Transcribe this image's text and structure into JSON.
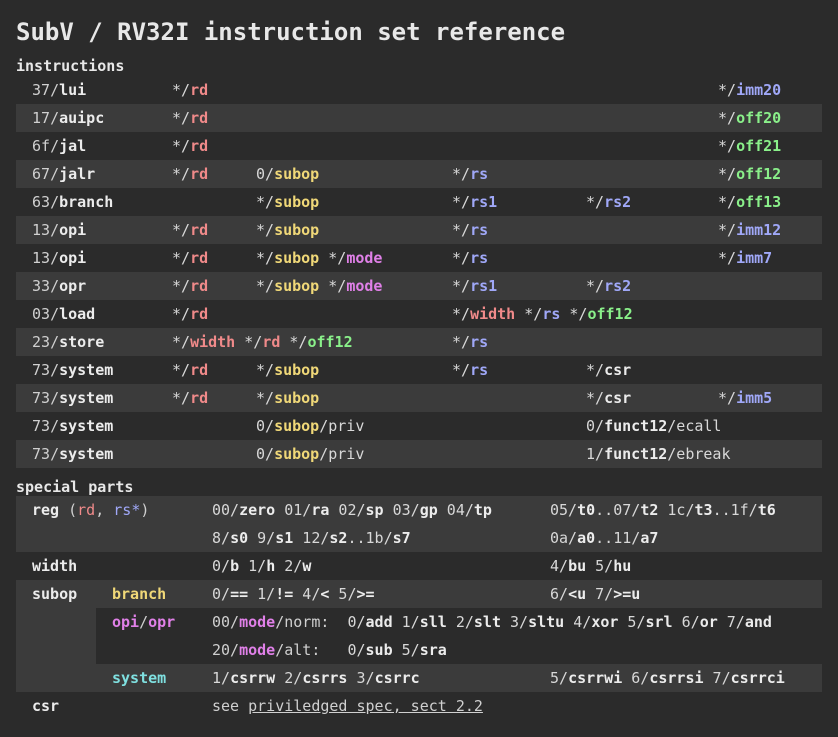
{
  "title": "SubV / RV32I instruction set reference",
  "sections": {
    "instructions": "instructions",
    "special": "special parts"
  },
  "instructions": [
    {
      "op": "37",
      "name": "lui",
      "c1p": "*/",
      "c1": "rd",
      "cLp": "*/",
      "cL": "imm20"
    },
    {
      "op": "17",
      "name": "auipc",
      "c1p": "*/",
      "c1": "rd",
      "cLp": "*/",
      "cL": "off20"
    },
    {
      "op": "6f",
      "name": "jal",
      "c1p": "*/",
      "c1": "rd",
      "cLp": "*/",
      "cL": "off21"
    },
    {
      "op": "67",
      "name": "jalr",
      "c1p": "*/",
      "c1": "rd",
      "c2p": "0/",
      "c2": "subop",
      "c3p": "*/",
      "c3": "rs",
      "cLp": "*/",
      "cL": "off12"
    },
    {
      "op": "63",
      "name": "branch",
      "c2p": "*/",
      "c2": "subop",
      "c3p": "*/",
      "c3": "rs1",
      "c4p": "*/",
      "c4": "rs2",
      "cLp": "*/",
      "cL": "off13"
    },
    {
      "op": "13",
      "name": "opi",
      "c1p": "*/",
      "c1": "rd",
      "c2p": "*/",
      "c2": "subop",
      "c3p": "*/",
      "c3": "rs",
      "cLp": "*/",
      "cL": "imm12"
    },
    {
      "op": "13",
      "name": "opi",
      "c1p": "*/",
      "c1": "rd",
      "c2p": "*/",
      "c2": "subop",
      "c2bp": " */",
      "c2b": "mode",
      "c3p": "*/",
      "c3": "rs",
      "cLp": "*/",
      "cL": "imm7"
    },
    {
      "op": "33",
      "name": "opr",
      "c1p": "*/",
      "c1": "rd",
      "c2p": "*/",
      "c2": "subop",
      "c2bp": " */",
      "c2b": "mode",
      "c3p": "*/",
      "c3": "rs1",
      "c4p": "*/",
      "c4": "rs2"
    },
    {
      "op": "03",
      "name": "load",
      "c1p": "*/",
      "c1": "rd",
      "c3p": "*/",
      "c3": "width",
      "c3bp": " */",
      "c3b": "rs",
      "c3cp": " */",
      "c3c": "off12"
    },
    {
      "op": "23",
      "name": "store",
      "c1p": "*/",
      "c1": "width",
      "c1bp": " */",
      "c1b": "rd",
      "c1cp": " */",
      "c1c": "off12",
      "c3p": "*/",
      "c3": "rs"
    },
    {
      "op": "73",
      "name": "system",
      "c1p": "*/",
      "c1": "rd",
      "c2p": "*/",
      "c2": "subop",
      "c3p": "*/",
      "c3": "rs",
      "c4p": "*/",
      "c4": "csr"
    },
    {
      "op": "73",
      "name": "system",
      "c1p": "*/",
      "c1": "rd",
      "c2p": "*/",
      "c2": "subop",
      "c4p": "*/",
      "c4": "csr",
      "cLp": "*/",
      "cL": "imm5"
    },
    {
      "op": "73",
      "name": "system",
      "c2p": "0/",
      "c2": "subop",
      "c2t": "/priv",
      "c4p": "0/",
      "c4": "funct12",
      "c4t": "/ecall"
    },
    {
      "op": "73",
      "name": "system",
      "c2p": "0/",
      "c2": "subop",
      "c2t": "/priv",
      "c4p": "1/",
      "c4": "funct12",
      "c4t": "/ebreak"
    }
  ],
  "special": {
    "reg": {
      "label": "reg",
      "open": " (",
      "rd": "rd",
      "comma": ", ",
      "rs": "rs*",
      "close": ")",
      "line1a": [
        {
          "n": "00/",
          "v": "zero"
        },
        {
          "n": " 01/",
          "v": "ra"
        },
        {
          "n": " 02/",
          "v": "sp"
        },
        {
          "n": " 03/",
          "v": "gp"
        },
        {
          "n": " 04/",
          "v": "tp"
        }
      ],
      "line1b": [
        {
          "n": "05/",
          "v": "t0"
        },
        {
          "n": "..07/",
          "v": "t2"
        },
        {
          "n": " 1c/",
          "v": "t3"
        },
        {
          "n": "..1f/",
          "v": "t6"
        }
      ],
      "line2a": [
        {
          "n": "8/",
          "v": "s0"
        },
        {
          "n": " 9/",
          "v": "s1"
        },
        {
          "n": " 12/",
          "v": "s2"
        },
        {
          "n": "..1b/",
          "v": "s7"
        }
      ],
      "line2b": [
        {
          "n": "0a/",
          "v": "a0"
        },
        {
          "n": "..11/",
          "v": "a7"
        }
      ]
    },
    "width": {
      "label": "width",
      "a": [
        {
          "n": "0/",
          "v": "b"
        },
        {
          "n": " 1/",
          "v": "h"
        },
        {
          "n": " 2/",
          "v": "w"
        }
      ],
      "b": [
        {
          "n": "4/",
          "v": "bu"
        },
        {
          "n": " 5/",
          "v": "hu"
        }
      ]
    },
    "subop": {
      "label": "subop",
      "branch": {
        "label": "branch",
        "a": [
          {
            "n": "0/",
            "v": "=="
          },
          {
            "n": " 1/",
            "v": "!="
          },
          {
            "n": " 4/",
            "v": "<"
          },
          {
            "n": " 5/",
            "v": ">="
          }
        ],
        "b": [
          {
            "n": "6/",
            "v": "<u"
          },
          {
            "n": " 7/",
            "v": ">=u"
          }
        ]
      },
      "opi": {
        "label1": "opi",
        "slash": "/",
        "label2": "opr",
        "norm": {
          "pre": "00/",
          "mode": "mode",
          "post": "/norm:  ",
          "items": [
            {
              "n": "0/",
              "v": "add"
            },
            {
              "n": " 1/",
              "v": "sll"
            },
            {
              "n": " 2/",
              "v": "slt"
            },
            {
              "n": " 3/",
              "v": "sltu"
            },
            {
              "n": " 4/",
              "v": "xor"
            },
            {
              "n": " 5/",
              "v": "srl"
            },
            {
              "n": " 6/",
              "v": "or"
            },
            {
              "n": " 7/",
              "v": "and"
            }
          ]
        },
        "alt": {
          "pre": "20/",
          "mode": "mode",
          "post": "/alt:   ",
          "items": [
            {
              "n": "0/",
              "v": "sub"
            },
            {
              "n": " 5/",
              "v": "sra"
            }
          ]
        }
      },
      "system": {
        "label": "system",
        "a": [
          {
            "n": "1/",
            "v": "csrrw"
          },
          {
            "n": " 2/",
            "v": "csrrs"
          },
          {
            "n": " 3/",
            "v": "csrrc"
          }
        ],
        "b": [
          {
            "n": "5/",
            "v": "csrrwi"
          },
          {
            "n": " 6/",
            "v": "csrrsi"
          },
          {
            "n": " 7/",
            "v": "csrrci"
          }
        ]
      }
    },
    "csr": {
      "label": "csr",
      "see": "see ",
      "link": "priviledged spec, sect 2.2"
    }
  }
}
